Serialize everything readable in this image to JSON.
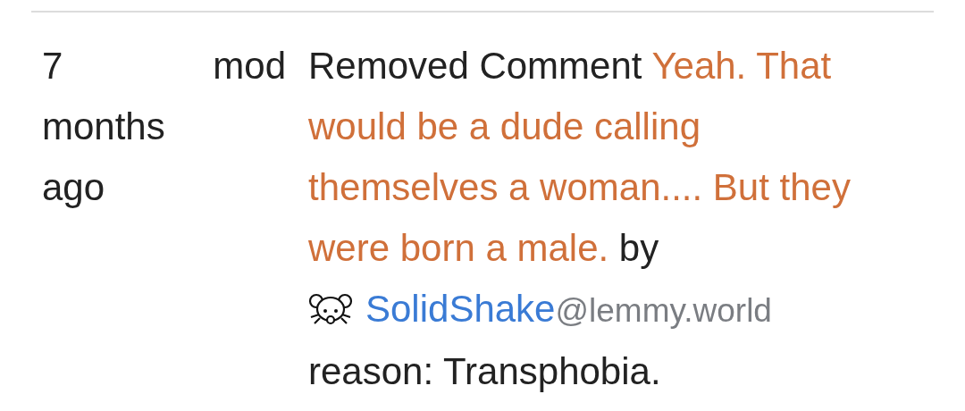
{
  "entries": [
    {
      "time": "7 months ago",
      "moderator": "mod",
      "action": "Removed Comment",
      "comment": "Yeah. That would be a dude calling themselves a woman.... But they were born a male.",
      "by": "by",
      "user": {
        "name": "SolidShake",
        "instance": "@lemmy.world"
      },
      "reason": "reason: Transphobia."
    }
  ]
}
